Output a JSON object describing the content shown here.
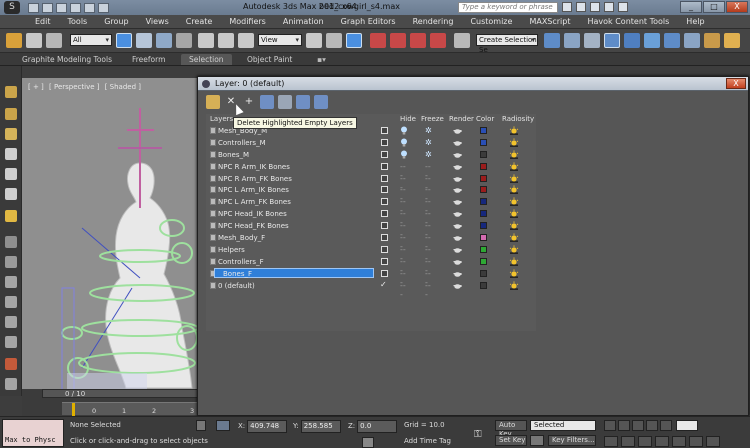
{
  "window": {
    "app_logo": "S",
    "title": "Autodesk 3ds Max  2012 x64",
    "file": "bed_cowgirl_s4.max",
    "search_placeholder": "Type a keyword or phrase",
    "buttons": {
      "minimize": "_",
      "maximize": "□",
      "close": "X"
    }
  },
  "menu": [
    "Edit",
    "Tools",
    "Group",
    "Views",
    "Create",
    "Modifiers",
    "Animation",
    "Graph Editors",
    "Rendering",
    "Customize",
    "MAXScript",
    "Havok Content Tools",
    "Help"
  ],
  "toolbar": {
    "filter_value": "All",
    "refcoord_value": "View",
    "selection_set_value": "Create Selection Se"
  },
  "ribbon": {
    "tabs": [
      "Graphite Modeling Tools",
      "Freeform",
      "Selection",
      "Object Paint"
    ],
    "active_tab": "Selection"
  },
  "viewport": {
    "label_parts": [
      "[ + ]",
      "[ Perspective ]",
      "[ Shaded ]"
    ]
  },
  "timeline": {
    "frame": "0 / 10",
    "ticks": [
      "0",
      "1",
      "2",
      "3"
    ]
  },
  "layer_dialog": {
    "title": "Layer: 0 (default)",
    "close": "X",
    "tooltip": "Delete Highlighted Empty Layers",
    "columns": {
      "layers": "Layers",
      "hide": "Hide",
      "freeze": "Freeze",
      "render": "Render",
      "color": "Color",
      "radiosity": "Radiosity"
    },
    "rows": [
      {
        "name": "Mesh_Body_M",
        "hidden": true,
        "color": "#2a4fb5"
      },
      {
        "name": "Controllers_M",
        "hidden": true,
        "color": "#2a4fb5"
      },
      {
        "name": "Bones_M",
        "hidden": true,
        "color": "#3b3b3b"
      },
      {
        "name": "NPC R Arm_IK Bones",
        "hidden": false,
        "color": "#9a1d1d"
      },
      {
        "name": "NPC R Arm_FK Bones",
        "hidden": false,
        "color": "#9a1d1d"
      },
      {
        "name": "NPC L Arm_IK Bones",
        "hidden": false,
        "color": "#9a1d1d"
      },
      {
        "name": "NPC L Arm_FK Bones",
        "hidden": false,
        "color": "#16287d"
      },
      {
        "name": "NPC Head_IK Bones",
        "hidden": false,
        "color": "#16287d"
      },
      {
        "name": "NPC Head_FK Bones",
        "hidden": false,
        "color": "#16287d"
      },
      {
        "name": "Mesh_Body_F",
        "hidden": false,
        "color": "#d46bb0"
      },
      {
        "name": "Helpers",
        "hidden": false,
        "color": "#2ea834"
      },
      {
        "name": "Controllers_F",
        "hidden": false,
        "color": "#2ea834"
      },
      {
        "name": "Bones_F",
        "hidden": false,
        "color": "#3b3b3b",
        "selected": true
      },
      {
        "name": "0 (default)",
        "hidden": false,
        "color": "#3b3b3b",
        "current": true
      }
    ],
    "check_mark": "✓"
  },
  "status": {
    "maxscript_text": "Max to Physc",
    "selection": "None Selected",
    "prompt": "Click or click-and-drag to select objects",
    "x_label": "X:",
    "x_value": "409.748",
    "y_label": "Y:",
    "y_value": "258.585",
    "z_label": "Z:",
    "z_value": "0.0",
    "grid": "Grid = 10.0",
    "add_time_tag": "Add Time Tag",
    "auto_key": "Auto Key",
    "set_key": "Set Key",
    "selected_value": "Selected",
    "key_filters": "Key Filters..."
  }
}
